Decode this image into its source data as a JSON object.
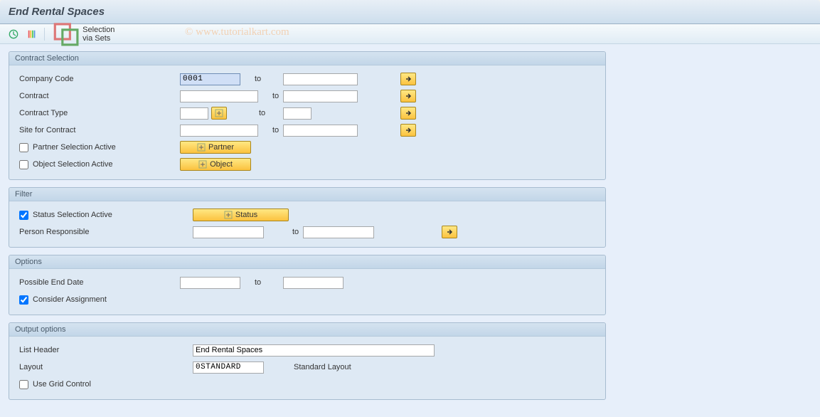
{
  "title": "End Rental Spaces",
  "toolbar": {
    "selection_via_sets": "Selection via Sets"
  },
  "watermark": "© www.tutorialkart.com",
  "contract_selection": {
    "title": "Contract Selection",
    "company_code": {
      "label": "Company Code",
      "from": "0001",
      "to_label": "to",
      "to": ""
    },
    "contract": {
      "label": "Contract",
      "from": "",
      "to_label": "to",
      "to": ""
    },
    "contract_type": {
      "label": "Contract Type",
      "from": "",
      "to_label": "to",
      "to": ""
    },
    "site": {
      "label": "Site for Contract",
      "from": "",
      "to_label": "to",
      "to": ""
    },
    "partner_active": {
      "label": "Partner Selection Active",
      "checked": false,
      "button": "Partner"
    },
    "object_active": {
      "label": "Object Selection Active",
      "checked": false,
      "button": "Object"
    }
  },
  "filter": {
    "title": "Filter",
    "status_active": {
      "label": "Status Selection Active",
      "checked": true,
      "button": "Status"
    },
    "person": {
      "label": "Person Responsible",
      "from": "",
      "to_label": "to",
      "to": ""
    }
  },
  "options": {
    "title": "Options",
    "end_date": {
      "label": "Possible End Date",
      "from": "",
      "to_label": "to",
      "to": ""
    },
    "consider": {
      "label": "Consider Assignment",
      "checked": true
    }
  },
  "output": {
    "title": "Output options",
    "list_header": {
      "label": "List Header",
      "value": "End Rental Spaces"
    },
    "layout": {
      "label": "Layout",
      "value": "0STANDARD",
      "desc": "Standard Layout"
    },
    "grid": {
      "label": "Use Grid Control",
      "checked": false
    }
  }
}
